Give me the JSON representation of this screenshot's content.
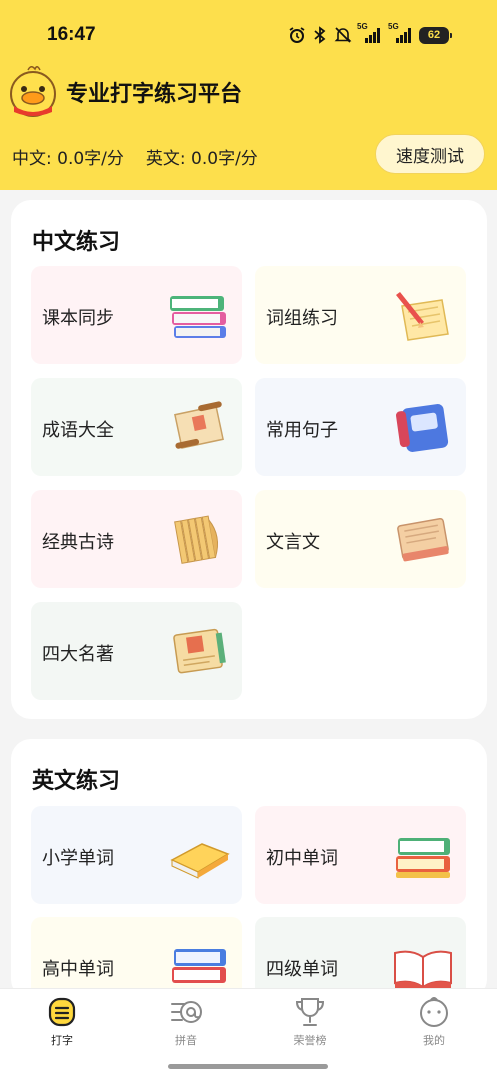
{
  "status_bar": {
    "time": "16:47",
    "network_1": "5G",
    "network_2": "5G",
    "battery": "62"
  },
  "header": {
    "title": "专业打字练习平台",
    "chinese_speed": "中文: 0.0字/分",
    "english_speed": "英文: 0.0字/分",
    "speed_test_button": "速度测试"
  },
  "chinese_section": {
    "title": "中文练习",
    "items": [
      {
        "label": "课本同步",
        "icon": "textbook-stack-icon"
      },
      {
        "label": "词组练习",
        "icon": "pencil-paper-icon"
      },
      {
        "label": "成语大全",
        "icon": "scroll-icon"
      },
      {
        "label": "常用句子",
        "icon": "blue-notebook-icon"
      },
      {
        "label": "经典古诗",
        "icon": "bamboo-slip-icon"
      },
      {
        "label": "文言文",
        "icon": "ancient-book-icon"
      },
      {
        "label": "四大名著",
        "icon": "classic-novel-icon"
      }
    ]
  },
  "english_section": {
    "title": "英文练习",
    "items": [
      {
        "label": "小学单词",
        "icon": "yellow-book-icon"
      },
      {
        "label": "初中单词",
        "icon": "green-book-stack-icon"
      },
      {
        "label": "高中单词",
        "icon": "blue-red-book-stack-icon"
      },
      {
        "label": "四级单词",
        "icon": "open-book-icon"
      }
    ]
  },
  "bottom_nav": [
    {
      "label": "打字",
      "icon": "typing-icon",
      "active": true
    },
    {
      "label": "拼音",
      "icon": "pinyin-icon",
      "active": false
    },
    {
      "label": "荣誉榜",
      "icon": "trophy-icon",
      "active": false
    },
    {
      "label": "我的",
      "icon": "profile-icon",
      "active": false
    }
  ],
  "colors": {
    "header_bg": "#fddf4c",
    "page_bg": "#f4f4f4",
    "accent": "#f5c400"
  }
}
